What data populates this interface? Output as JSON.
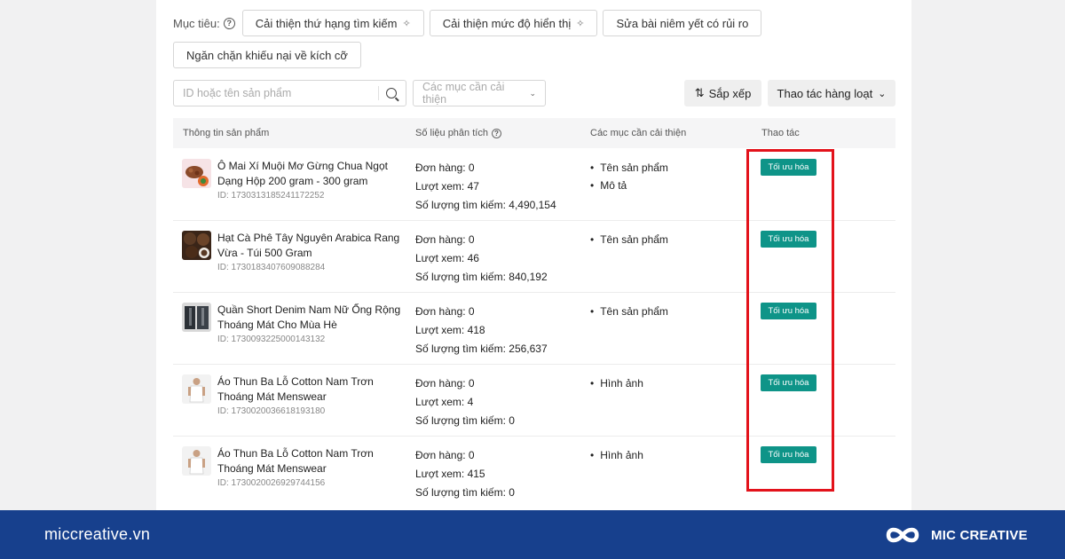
{
  "goals": {
    "label": "Mục tiêu:",
    "chips": [
      {
        "label": "Cải thiện thứ hạng tìm kiếm",
        "spark": true
      },
      {
        "label": "Cải thiện mức độ hiển thị",
        "spark": true
      },
      {
        "label": "Sửa bài niêm yết có rủi ro",
        "spark": false
      },
      {
        "label": "Ngăn chặn khiếu nại về kích cỡ",
        "spark": false
      }
    ]
  },
  "toolbar": {
    "search_placeholder": "ID hoặc tên sản phẩm",
    "filter_placeholder": "Các mục cần cải thiện",
    "sort_label": "Sắp xếp",
    "bulk_label": "Thao tác hàng loạt"
  },
  "table": {
    "headers": {
      "product": "Thông tin sản phẩm",
      "metrics": "Số liệu phân tích",
      "improve": "Các mục cần cải thiện",
      "action": "Thao tác"
    },
    "rows": [
      {
        "name": "Ô Mai Xí Muội Mơ Gừng Chua Ngọt Dạng Hộp 200 gram - 300 gram",
        "id": "ID: 1730313185241172252",
        "orders": "Đơn hàng: 0",
        "views": "Lượt xem: 47",
        "searches": "Số lượng tìm kiếm: 4,490,154",
        "improve": [
          "Tên sản phẩm",
          "Mô tả"
        ],
        "action": "Tối ưu hóa",
        "thumb": "plum"
      },
      {
        "name": "Hạt Cà Phê Tây Nguyên Arabica Rang Vừa - Túi 500 Gram",
        "id": "ID: 1730183407609088284",
        "orders": "Đơn hàng: 0",
        "views": "Lượt xem: 46",
        "searches": "Số lượng tìm kiếm: 840,192",
        "improve": [
          "Tên sản phẩm"
        ],
        "action": "Tối ưu hóa",
        "thumb": "coffee"
      },
      {
        "name": "Quần Short Denim Nam Nữ Ống Rộng Thoáng Mát Cho Mùa Hè",
        "id": "ID: 1730093225000143132",
        "orders": "Đơn hàng: 0",
        "views": "Lượt xem: 418",
        "searches": "Số lượng tìm kiếm: 256,637",
        "improve": [
          "Tên sản phẩm"
        ],
        "action": "Tối ưu hóa",
        "thumb": "denim"
      },
      {
        "name": "Áo Thun Ba Lỗ Cotton Nam Trơn Thoáng Mát Menswear",
        "id": "ID: 1730020036618193180",
        "orders": "Đơn hàng: 0",
        "views": "Lượt xem: 4",
        "searches": "Số lượng tìm kiếm: 0",
        "improve": [
          "Hình ảnh"
        ],
        "action": "Tối ưu hóa",
        "thumb": "tank"
      },
      {
        "name": "Áo Thun Ba Lỗ Cotton Nam Trơn Thoáng Mát Menswear",
        "id": "ID: 1730020026929744156",
        "orders": "Đơn hàng: 0",
        "views": "Lượt xem: 415",
        "searches": "Số lượng tìm kiếm: 0",
        "improve": [
          "Hình ảnh"
        ],
        "action": "Tối ưu hóa",
        "thumb": "tank"
      }
    ]
  },
  "footer": {
    "url": "miccreative.vn",
    "brand": "MIC CREATIVE"
  },
  "colors": {
    "accent": "#0e9488",
    "highlight": "#e3121b",
    "footer_bg": "#17408d"
  }
}
